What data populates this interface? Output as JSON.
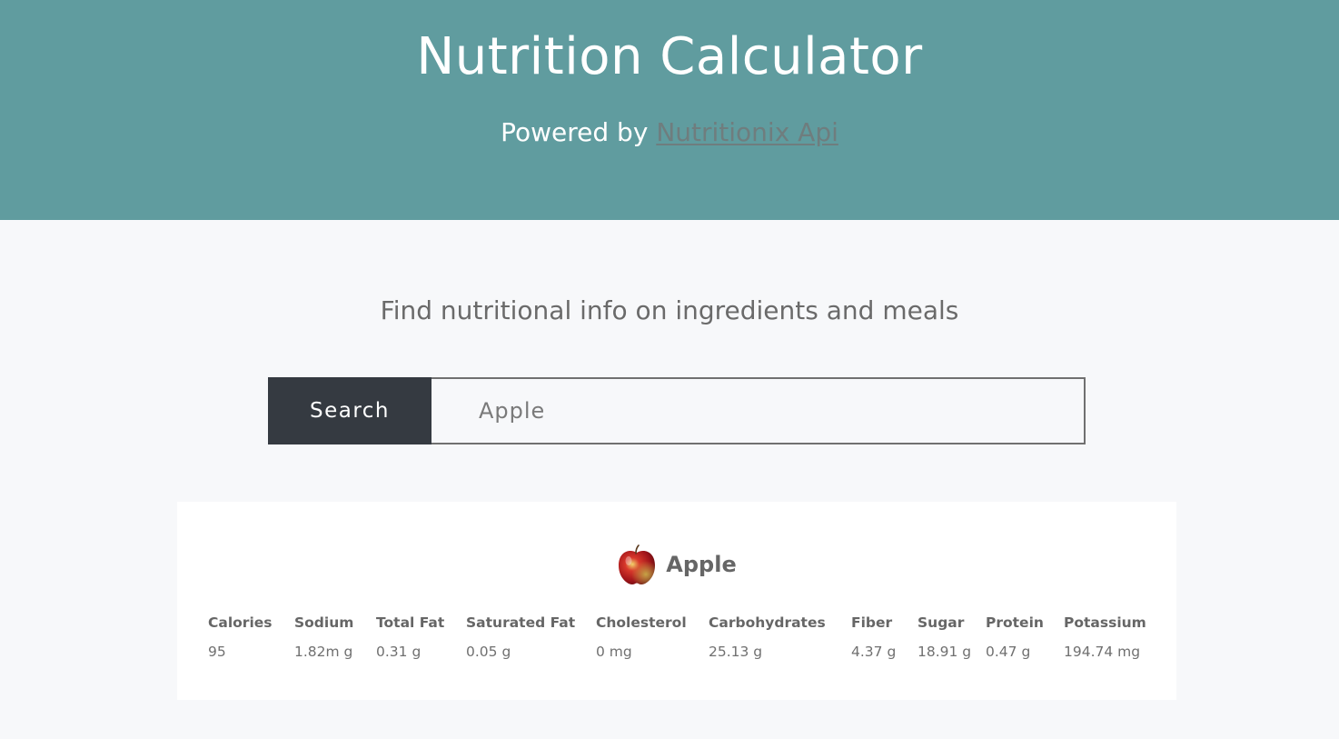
{
  "header": {
    "title": "Nutrition Calculator",
    "powered_prefix": "Powered by",
    "powered_link": "Nutritionix Api"
  },
  "tagline": "Find nutritional info on ingredients and meals",
  "search": {
    "button_label": "Search",
    "value": "Apple"
  },
  "result": {
    "food_name": "Apple",
    "thumb_icon": "apple-photo",
    "nutrients": [
      {
        "label": "Calories",
        "value": "95"
      },
      {
        "label": "Sodium",
        "value": "1.82m g"
      },
      {
        "label": "Total Fat",
        "value": "0.31 g"
      },
      {
        "label": "Saturated Fat",
        "value": "0.05 g"
      },
      {
        "label": "Cholesterol",
        "value": "0 mg"
      },
      {
        "label": "Carbohydrates",
        "value": "25.13 g"
      },
      {
        "label": "Fiber",
        "value": "4.37 g"
      },
      {
        "label": "Sugar",
        "value": "18.91 g"
      },
      {
        "label": "Protein",
        "value": "0.47 g"
      },
      {
        "label": "Potassium",
        "value": "194.74 mg"
      }
    ]
  },
  "colors": {
    "hero_bg": "#609c9f",
    "button_bg": "#353a41",
    "page_bg": "#f7f8fa"
  }
}
